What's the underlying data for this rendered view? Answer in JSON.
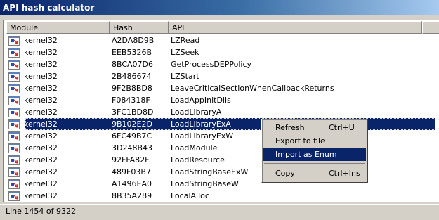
{
  "window": {
    "title": "API hash calculator"
  },
  "columns": [
    "Module",
    "Hash",
    "API"
  ],
  "rows": [
    {
      "module": "kernel32",
      "hash": "A2DA8D9B",
      "api": "LZRead"
    },
    {
      "module": "kernel32",
      "hash": "EEB5326B",
      "api": "LZSeek"
    },
    {
      "module": "kernel32",
      "hash": "8BCA07D6",
      "api": "GetProcessDEPPolicy"
    },
    {
      "module": "kernel32",
      "hash": "2B486674",
      "api": "LZStart"
    },
    {
      "module": "kernel32",
      "hash": "9F2B8BD8",
      "api": "LeaveCriticalSectionWhenCallbackReturns"
    },
    {
      "module": "kernel32",
      "hash": "F084318F",
      "api": "LoadAppInitDlls"
    },
    {
      "module": "kernel32",
      "hash": "3FC1BD8D",
      "api": "LoadLibraryA"
    },
    {
      "module": "kernel32",
      "hash": "9B102E2D",
      "api": "LoadLibraryExA",
      "selected": true
    },
    {
      "module": "kernel32",
      "hash": "6FC49B7C",
      "api": "LoadLibraryExW"
    },
    {
      "module": "kernel32",
      "hash": "3D248B43",
      "api": "LoadModule"
    },
    {
      "module": "kernel32",
      "hash": "92FFA82F",
      "api": "LoadResource"
    },
    {
      "module": "kernel32",
      "hash": "489F03B7",
      "api": "LoadStringBaseExW"
    },
    {
      "module": "kernel32",
      "hash": "A1496EA0",
      "api": "LoadStringBaseW"
    },
    {
      "module": "kernel32",
      "hash": "8B35A289",
      "api": "LocalAlloc"
    }
  ],
  "status": {
    "text": "Line 1454 of 9322"
  },
  "context_menu": {
    "items": [
      {
        "label": "Refresh",
        "shortcut": "Ctrl+U"
      },
      {
        "label": "Export to file",
        "shortcut": ""
      },
      {
        "label": "Import as Enum",
        "shortcut": "",
        "highlighted": true
      },
      {
        "separator": true
      },
      {
        "label": "Copy",
        "shortcut": "Ctrl+Ins"
      }
    ]
  },
  "colors": {
    "selection": "#0a246a",
    "window_bg": "#d4d0c8"
  },
  "icons": {
    "row": "dll-module-icon"
  }
}
